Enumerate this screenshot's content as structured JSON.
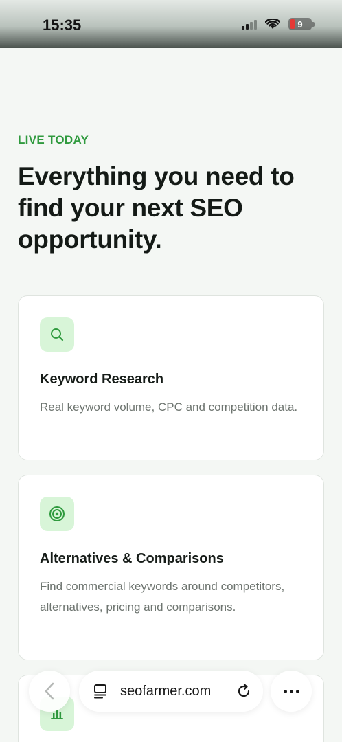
{
  "status_bar": {
    "time": "15:35",
    "battery_level": "9"
  },
  "hero": {
    "eyebrow": "LIVE TODAY",
    "headline": "Everything you need to find your next SEO opportunity."
  },
  "features": [
    {
      "icon": "search-icon",
      "title": "Keyword Research",
      "description": "Real keyword volume, CPC and competition data."
    },
    {
      "icon": "target-icon",
      "title": "Alternatives & Comparisons",
      "description": "Find commercial keywords around competitors, alternatives, pricing and comparisons."
    },
    {
      "icon": "bar-chart-icon"
    }
  ],
  "browser": {
    "url": "seofarmer.com"
  },
  "colors": {
    "accent": "#2f9a3e",
    "icon_bg": "#d8f5d8",
    "background": "#f4f7f4"
  }
}
